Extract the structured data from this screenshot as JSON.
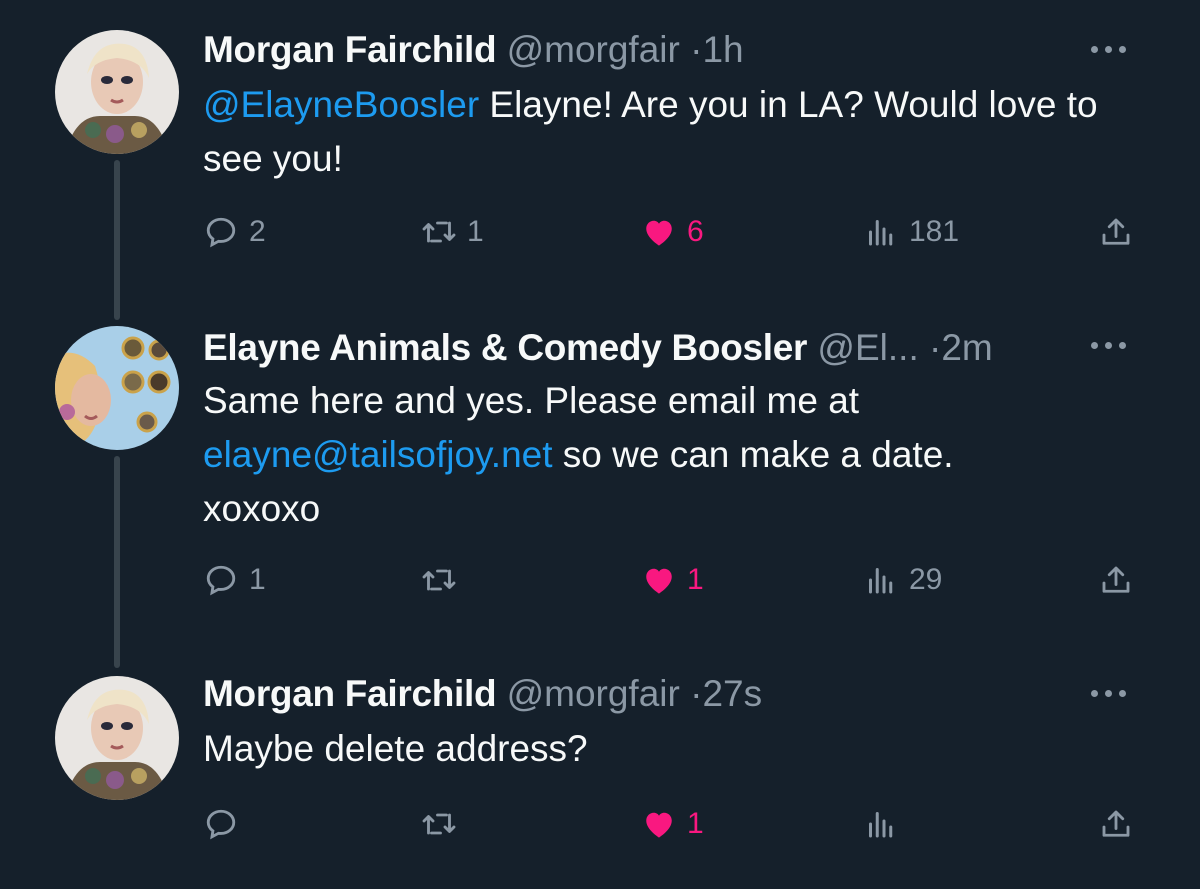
{
  "tweets": [
    {
      "name": "Morgan Fairchild",
      "handle": "@morgfair",
      "dot": "·",
      "time": "1h",
      "mention": "@ElayneBoosler",
      "text_before": "",
      "text_after": " Elayne! Are you in LA? Would love to see you!",
      "replies": "2",
      "retweets": "1",
      "likes": "6",
      "views": "181",
      "liked": true,
      "avatar_icon": "avatar-photo"
    },
    {
      "name": "Elayne Animals & Comedy Boosler",
      "handle": "@El...",
      "dot": "·",
      "time": "2m",
      "text_before": "Same here and yes. Please email me at ",
      "email": "elayne@tailsofjoy.net",
      "text_after": " so we can make a date. xoxoxo",
      "replies": "1",
      "retweets": "",
      "likes": "1",
      "views": "29",
      "liked": true,
      "avatar_icon": "avatar-photo"
    },
    {
      "name": "Morgan Fairchild",
      "handle": "@morgfair",
      "dot": "·",
      "time": "27s",
      "text": "Maybe delete address?",
      "replies": "",
      "retweets": "",
      "likes": "1",
      "views": "",
      "liked": true,
      "avatar_icon": "avatar-photo"
    }
  ],
  "icons": {
    "reply": "reply-icon",
    "retweet": "retweet-icon",
    "like": "heart-icon",
    "views": "views-icon",
    "share": "share-icon",
    "more": "more-icon"
  },
  "colors": {
    "background": "#15202b",
    "link": "#1d9bf0",
    "like": "#f91880",
    "muted": "#8b98a5",
    "text": "#f7f9f9"
  }
}
